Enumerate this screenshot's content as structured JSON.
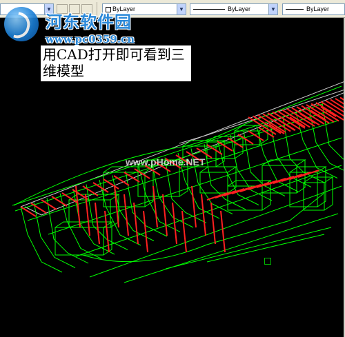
{
  "toolbar": {
    "layer_combo_value": "",
    "color_combo_value": "ByLayer",
    "linetype_combo_value": "ByLayer",
    "lineweight_combo_value": "ByLayer",
    "dropdown_glyph": "▼"
  },
  "watermark": {
    "site_name": "河东软件园",
    "site_url": "www.pc0359.cn",
    "mid_text": "www.pHome.NET"
  },
  "caption": {
    "text": "用CAD打开即可看到三\n维模型"
  },
  "colors": {
    "background": "#000000",
    "wire_green": "#00ff00",
    "wire_red": "#ff2020",
    "wire_white": "#c8c8c8"
  }
}
